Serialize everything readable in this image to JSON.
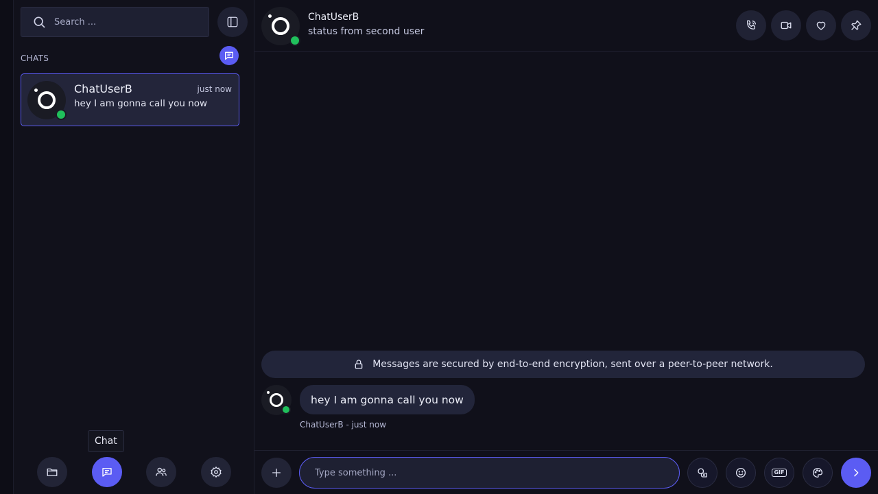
{
  "sidebar": {
    "search_placeholder": "Search ...",
    "section_title": "CHATS",
    "chats": [
      {
        "name": "ChatUserB",
        "time": "just now",
        "preview": "hey I am gonna call you now",
        "online": true,
        "selected": true
      }
    ],
    "tooltip": "Chat",
    "nav": [
      {
        "icon": "folder-icon",
        "label": "Files"
      },
      {
        "icon": "chat-icon",
        "label": "Chat",
        "active": true
      },
      {
        "icon": "friends-icon",
        "label": "Friends"
      },
      {
        "icon": "settings-icon",
        "label": "Settings"
      }
    ]
  },
  "conversation": {
    "header": {
      "name": "ChatUserB",
      "status": "status from second user",
      "actions": [
        "phone-icon",
        "video-icon",
        "heart-icon",
        "pin-icon"
      ]
    },
    "encryption_notice": "Messages are secured by end-to-end encryption, sent over a peer-to-peer network.",
    "messages": [
      {
        "text": "hey I am gonna call you now",
        "meta": "ChatUserB - just now"
      }
    ],
    "composer": {
      "placeholder": "Type something ...",
      "buttons": [
        "plus-icon",
        "sticker-icon",
        "emoji-icon",
        "gif-icon",
        "palette-icon",
        "send-icon"
      ]
    }
  },
  "colors": {
    "accent": "#5b5cf3",
    "online": "#20c05c",
    "background": "#10101a",
    "surface": "#22253a"
  }
}
